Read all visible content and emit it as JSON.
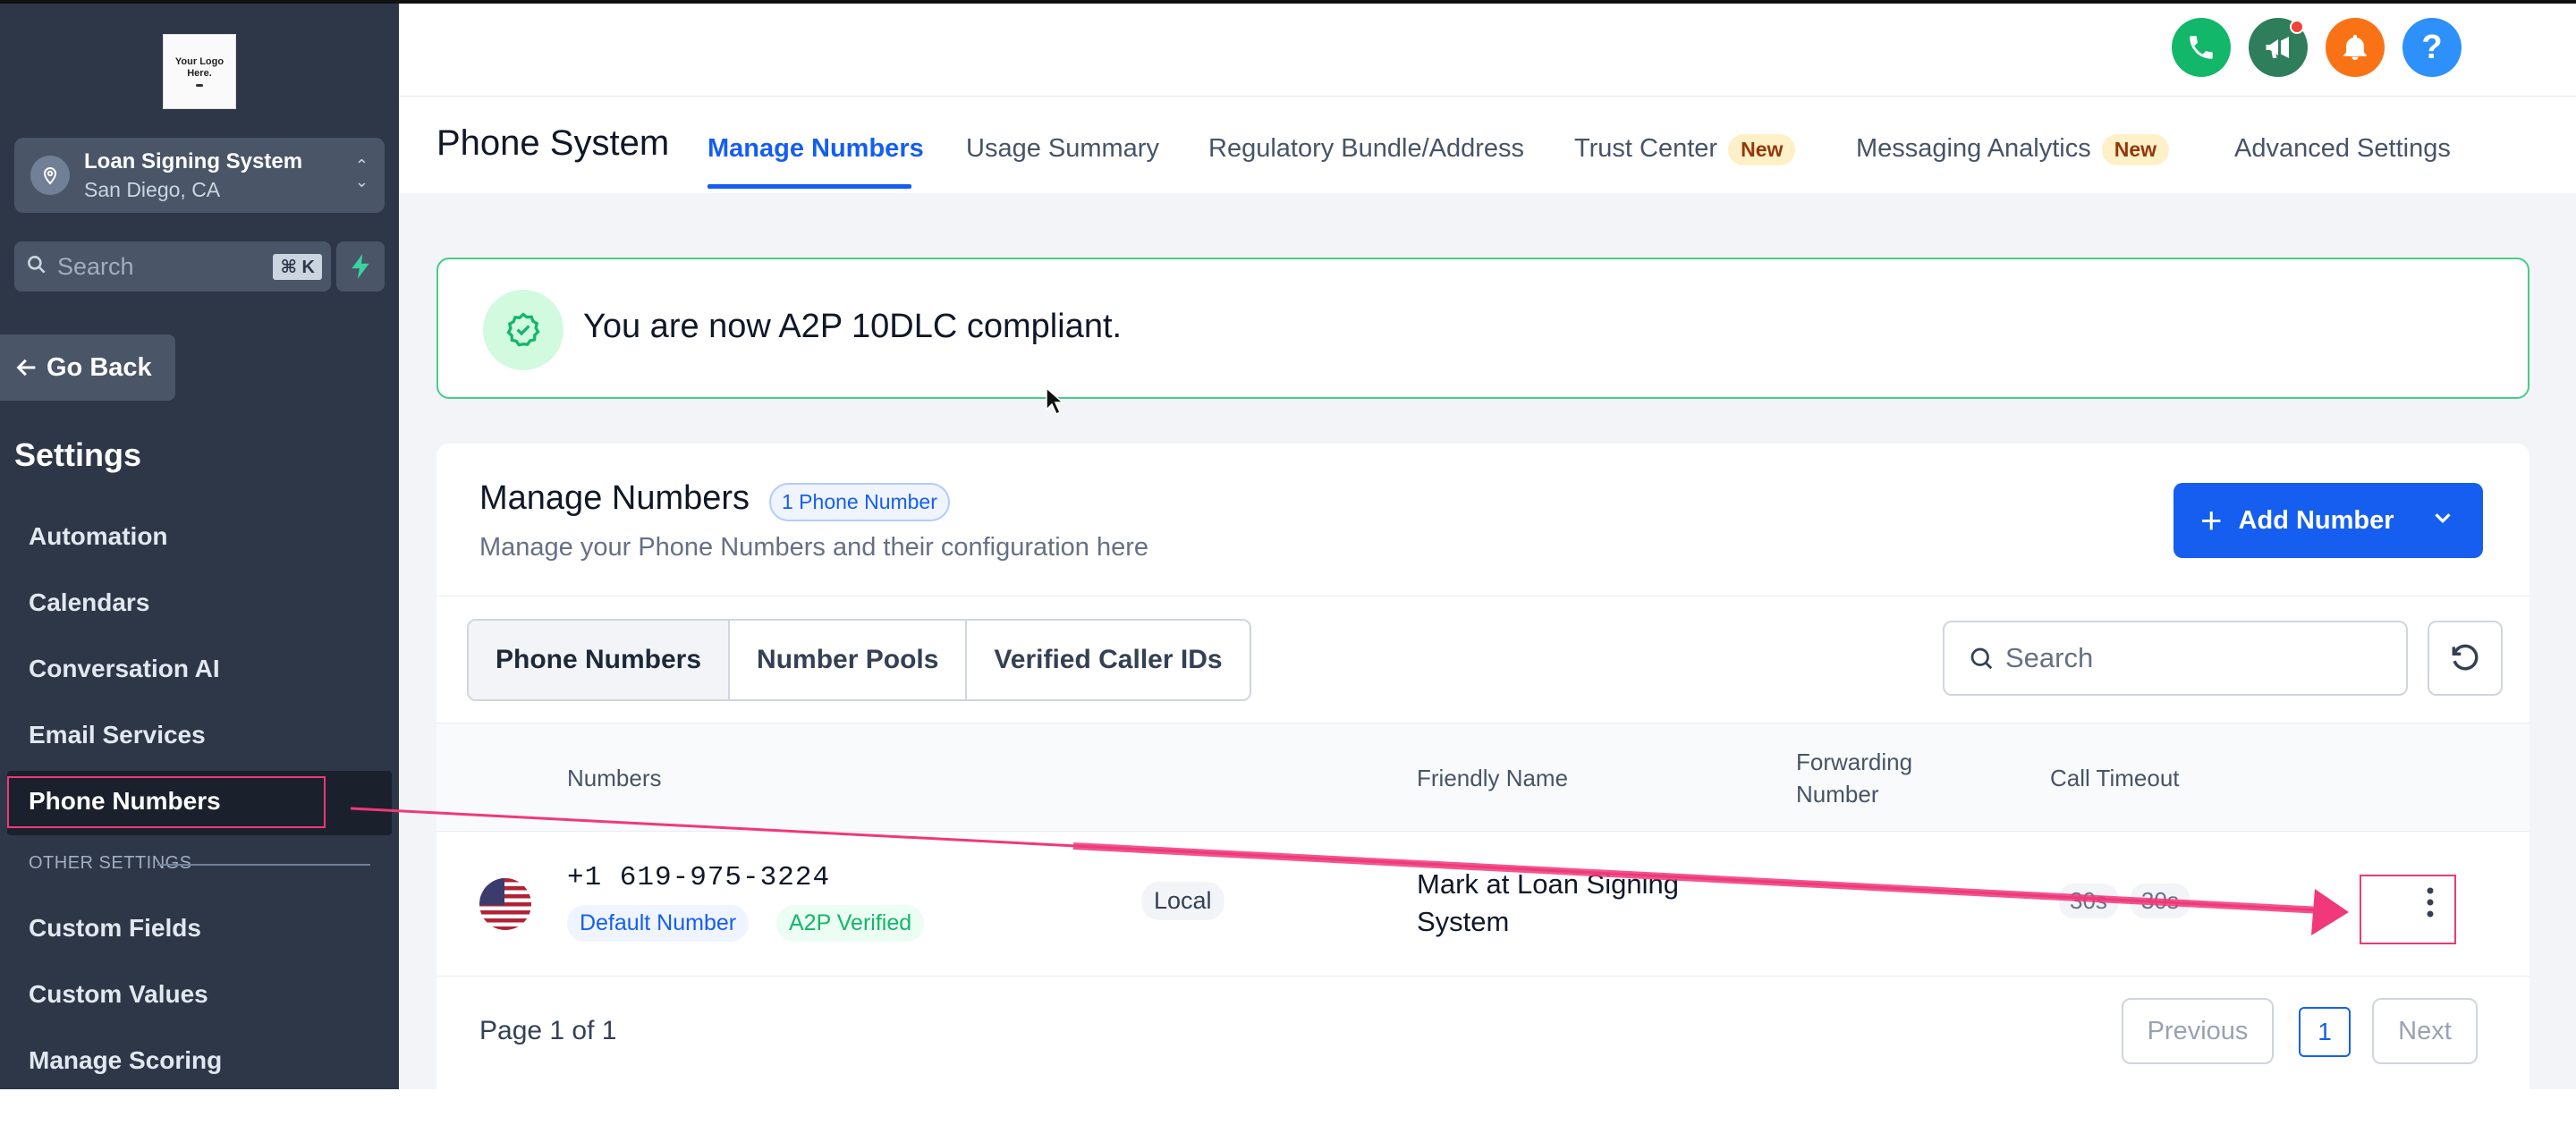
{
  "sidebar": {
    "logo_text": "Your Logo Here.",
    "account_name": "Loan Signing System",
    "account_location": "San Diego, CA",
    "search_placeholder": "Search",
    "search_shortcut": "⌘ K",
    "go_back": "Go Back",
    "settings_title": "Settings",
    "items": [
      {
        "label": "Automation"
      },
      {
        "label": "Calendars"
      },
      {
        "label": "Conversation AI"
      },
      {
        "label": "Email Services"
      },
      {
        "label": "Phone Numbers"
      }
    ],
    "other_settings_label": "OTHER SETTINGS",
    "other_items": [
      {
        "label": "Custom Fields"
      },
      {
        "label": "Custom Values"
      },
      {
        "label": "Manage Scoring"
      }
    ]
  },
  "header": {
    "icons": [
      "phone-icon",
      "megaphone-icon",
      "bell-icon",
      "help-icon",
      "avatar"
    ],
    "colors": {
      "phone": "#12b76a",
      "megaphone": "#2e7d5b",
      "bell": "#f97316",
      "help": "#2e90fa"
    }
  },
  "tabs": {
    "page_title": "Phone System",
    "items": [
      {
        "label": "Manage Numbers",
        "active": true
      },
      {
        "label": "Usage Summary"
      },
      {
        "label": "Regulatory Bundle/Address"
      },
      {
        "label": "Trust Center",
        "badge": "New"
      },
      {
        "label": "Messaging Analytics",
        "badge": "New"
      },
      {
        "label": "Advanced Settings"
      }
    ]
  },
  "banner": {
    "message": "You are now A2P 10DLC compliant."
  },
  "manage": {
    "title": "Manage Numbers",
    "count_badge": "1 Phone Number",
    "subtitle": "Manage your Phone Numbers and their configuration here",
    "add_button": "Add Number",
    "segments": [
      "Phone Numbers",
      "Number Pools",
      "Verified Caller IDs"
    ],
    "search_placeholder": "Search",
    "columns": {
      "numbers": "Numbers",
      "friendly_name": "Friendly Name",
      "forwarding_line1": "Forwarding",
      "forwarding_line2": "Number",
      "call_timeout": "Call Timeout"
    },
    "rows": [
      {
        "number": "+1 619-975-3224",
        "tags": [
          "Default Number",
          "A2P Verified"
        ],
        "type": "Local",
        "friendly_name": "Mark at Loan Signing System",
        "timeout_a": "30s",
        "timeout_b": "30s"
      }
    ],
    "pagination": {
      "summary": "Page 1 of 1",
      "previous": "Previous",
      "current": "1",
      "next": "Next"
    }
  },
  "colors": {
    "accent": "#155eef",
    "sidebar_bg": "#2d3748",
    "annotation": "#f0387a",
    "success": "#47cd89"
  }
}
